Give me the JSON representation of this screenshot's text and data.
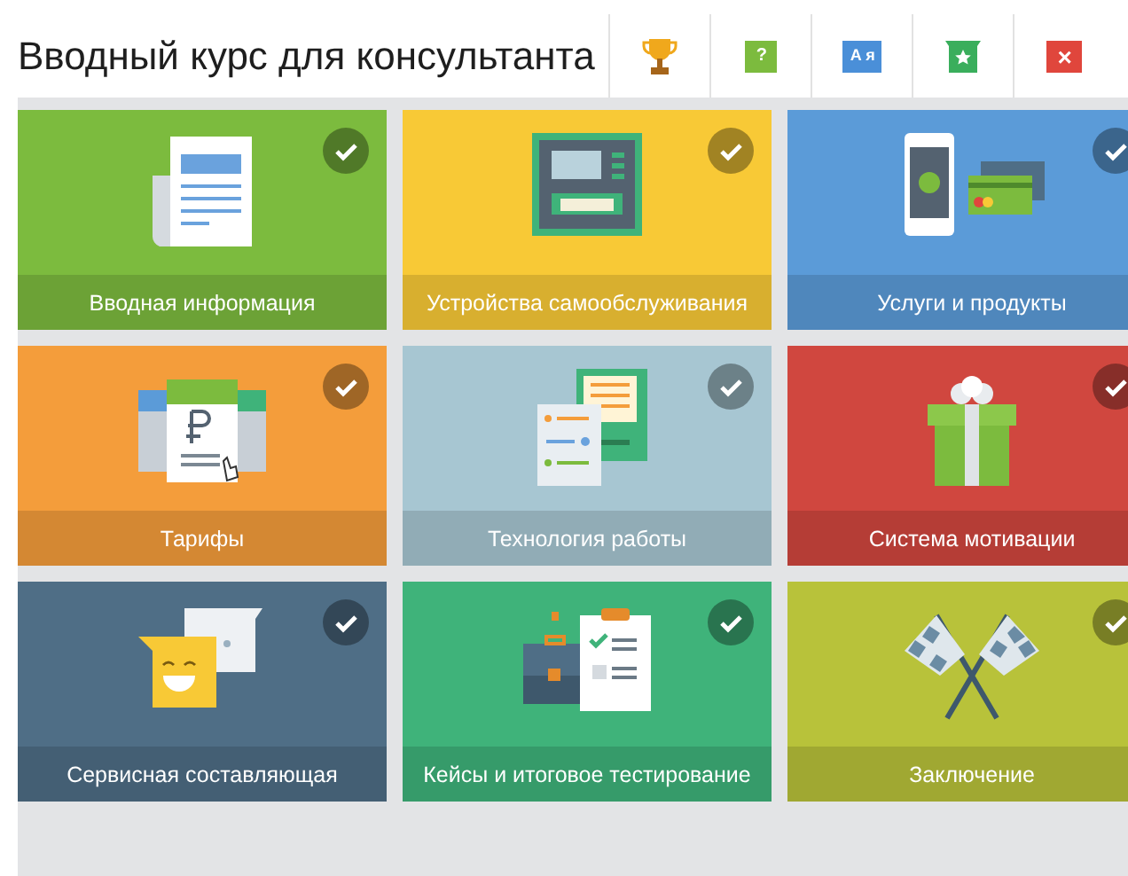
{
  "header": {
    "title": "Вводный курс для консультанта"
  },
  "toolbar": [
    {
      "kind": "trophy"
    },
    {
      "kind": "help",
      "label": "?"
    },
    {
      "kind": "language",
      "label": "A я"
    },
    {
      "kind": "star"
    },
    {
      "kind": "close",
      "label": "×"
    }
  ],
  "tiles": [
    {
      "label": "Вводная информация",
      "kind": "document",
      "completed": true,
      "color": "#7cbb3e"
    },
    {
      "label": "Устройства самообслуживания",
      "kind": "atm",
      "completed": true,
      "color": "#f8c936"
    },
    {
      "label": "Услуги и продукты",
      "kind": "phone",
      "completed": true,
      "color": "#5b9bd8"
    },
    {
      "label": "Тарифы",
      "kind": "tariff",
      "completed": true,
      "color": "#f49d3b"
    },
    {
      "label": "Технология работы",
      "kind": "terminal",
      "completed": true,
      "color": "#a7c6d2"
    },
    {
      "label": "Система мотивации",
      "kind": "gift",
      "completed": true,
      "color": "#d0473f"
    },
    {
      "label": "Сервисная составляющая",
      "kind": "chat",
      "completed": true,
      "color": "#4f6e86"
    },
    {
      "label": "Кейсы и итоговое тестирование",
      "kind": "case",
      "completed": true,
      "color": "#3fb37a"
    },
    {
      "label": "Заключение",
      "kind": "flags",
      "completed": true,
      "color": "#b8c23a"
    }
  ]
}
